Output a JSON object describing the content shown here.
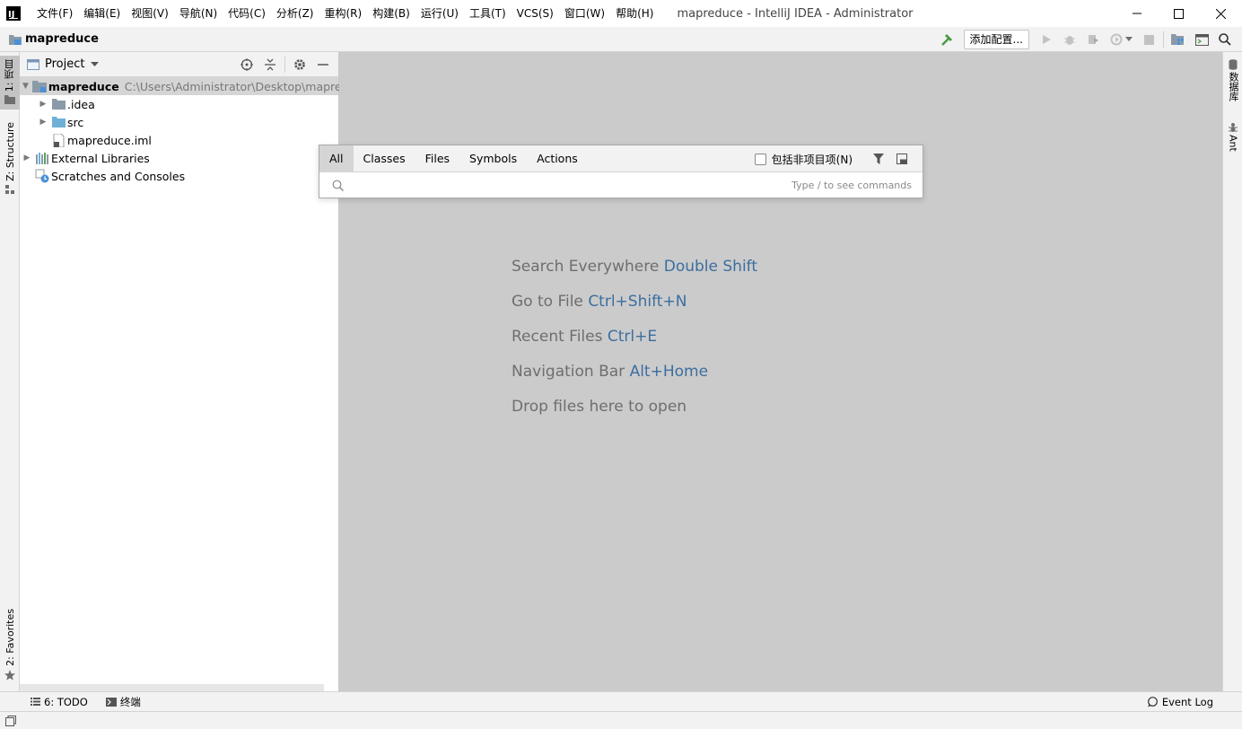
{
  "app": {
    "logo_text": "IJ",
    "window_title": "mapreduce - IntelliJ IDEA - Administrator"
  },
  "menu": [
    "文件(F)",
    "编辑(E)",
    "视图(V)",
    "导航(N)",
    "代码(C)",
    "分析(Z)",
    "重构(R)",
    "构建(B)",
    "运行(U)",
    "工具(T)",
    "VCS(S)",
    "窗口(W)",
    "帮助(H)"
  ],
  "navbar": {
    "project_name": "mapreduce",
    "add_config_label": "添加配置..."
  },
  "left_strip": {
    "project_tab": "1: 项目",
    "structure_tab": "Z: Structure",
    "favorites_tab": "2: Favorites"
  },
  "project_panel": {
    "title": "Project",
    "tree": [
      {
        "label": "mapreduce",
        "path": "C:\\Users\\Administrator\\Desktop\\mapreduce",
        "icon": "module-folder-icon",
        "expanded": true,
        "selected": true
      },
      {
        "label": ".idea",
        "icon": "folder-icon",
        "expanded": false
      },
      {
        "label": "src",
        "icon": "source-folder-icon",
        "expanded": false
      },
      {
        "label": "mapreduce.iml",
        "icon": "iml-file-icon"
      },
      {
        "label": "External Libraries",
        "icon": "library-icon",
        "expanded": false
      },
      {
        "label": "Scratches and Consoles",
        "icon": "scratches-icon"
      }
    ]
  },
  "editor_hints": [
    {
      "text": "Search Everywhere",
      "key": "Double Shift"
    },
    {
      "text": "Go to File",
      "key": "Ctrl+Shift+N"
    },
    {
      "text": "Recent Files",
      "key": "Ctrl+E"
    },
    {
      "text": "Navigation Bar",
      "key": "Alt+Home"
    },
    {
      "text": "Drop files here to open",
      "key": ""
    }
  ],
  "right_strip": {
    "database_tab": "数据库",
    "ant_tab": "Ant"
  },
  "bottom_bar": {
    "todo_label": "6: TODO",
    "terminal_label": "终端",
    "event_log_label": "Event Log"
  },
  "search_popup": {
    "tabs": [
      "All",
      "Classes",
      "Files",
      "Symbols",
      "Actions"
    ],
    "active_tab": "All",
    "include_non_project_label": "包括非项目项(N)",
    "include_non_project_checked": false,
    "query": "",
    "hint": "Type / to see commands"
  },
  "colors": {
    "editor_bg": "#cbcbcb",
    "shortcut_key": "#3c6ea0",
    "build_hammer": "#4c9a45"
  }
}
